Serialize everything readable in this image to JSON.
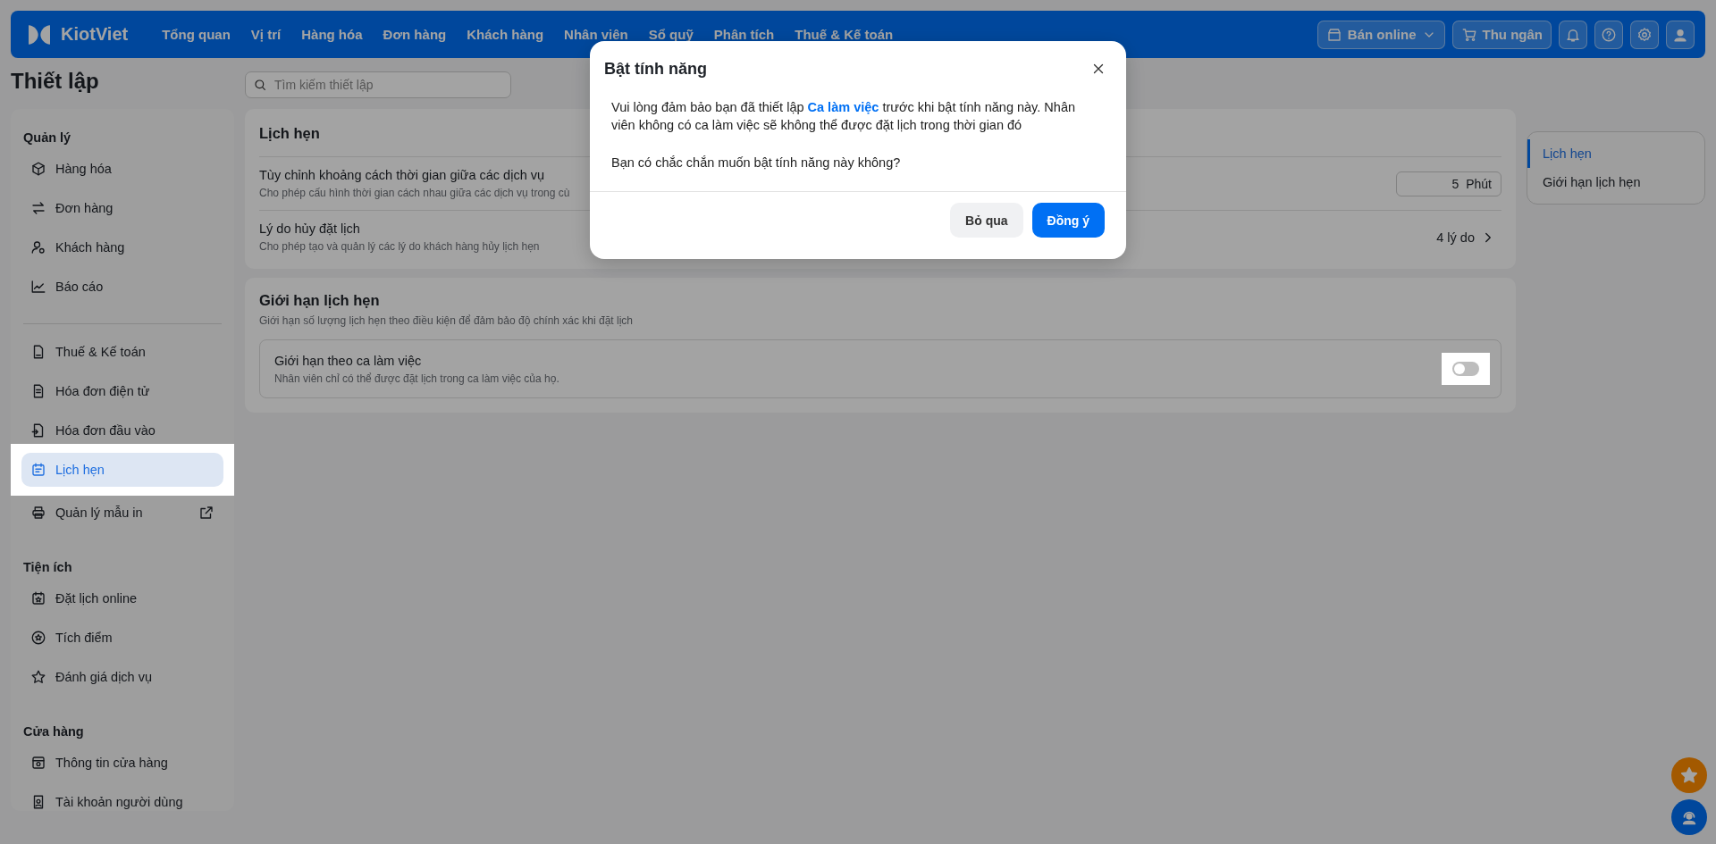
{
  "topbar": {
    "logo": "KiotViet",
    "menu": [
      "Tổng quan",
      "Vị trí",
      "Hàng hóa",
      "Đơn hàng",
      "Khách hàng",
      "Nhân viên",
      "Sổ quỹ",
      "Phân tích",
      "Thuế & Kế toán"
    ],
    "online_button": "Bán online",
    "cashier_button": "Thu ngân"
  },
  "page_title": "Thiết lập",
  "search": {
    "placeholder": "Tìm kiếm thiết lập"
  },
  "sidebar": {
    "sections": [
      {
        "title": "Quản lý",
        "items": [
          {
            "label": "Hàng hóa",
            "selected": false,
            "kind": "link"
          },
          {
            "label": "Đơn hàng",
            "selected": false,
            "kind": "link"
          },
          {
            "label": "Khách hàng",
            "selected": false,
            "kind": "link"
          },
          {
            "label": "Báo cáo",
            "selected": false,
            "kind": "link"
          }
        ]
      },
      {
        "items": [
          {
            "label": "Thuế & Kế toán",
            "selected": false,
            "kind": "link"
          },
          {
            "label": "Hóa đơn điện tử",
            "selected": false,
            "kind": "link"
          },
          {
            "label": "Hóa đơn đầu vào",
            "selected": false,
            "kind": "link"
          },
          {
            "label": "Lịch hẹn",
            "selected": true,
            "kind": "link"
          },
          {
            "label": "Quản lý mẫu in",
            "selected": false,
            "kind": "external"
          }
        ]
      },
      {
        "title": "Tiện ích",
        "items": [
          {
            "label": "Đặt lịch online",
            "selected": false,
            "kind": "link"
          },
          {
            "label": "Tích điểm",
            "selected": false,
            "kind": "link"
          },
          {
            "label": "Đánh giá dịch vụ",
            "selected": false,
            "kind": "link"
          }
        ]
      },
      {
        "title": "Cửa hàng",
        "items": [
          {
            "label": "Thông tin cửa hàng",
            "selected": false,
            "kind": "link"
          },
          {
            "label": "Tài khoản người dùng",
            "selected": false,
            "kind": "link"
          }
        ]
      }
    ]
  },
  "appointments": {
    "title": "Lịch hẹn",
    "rows": [
      {
        "kind": "stepper",
        "title": "Tùy chỉnh khoảng cách thời gian giữa các dịch vụ",
        "description": "Cho phép cấu hình thời gian cách nhau giữa các dịch vụ trong cù",
        "value": "5",
        "unit": "Phút"
      },
      {
        "kind": "link",
        "title": "Lý do hủy đặt lịch",
        "description": "Cho phép tạo và quản lý các lý do khách hàng hủy lịch hẹn",
        "value": "4 lý do"
      }
    ]
  },
  "limits": {
    "title": "Giới hạn lịch hẹn",
    "description": "Giới hạn số lượng lịch hẹn theo điều kiện để đảm bảo độ chính xác khi đặt lịch",
    "option": {
      "title": "Giới hạn theo ca làm việc",
      "description": "Nhân viên chỉ có thể được đặt lịch trong ca làm việc của họ.",
      "on": false
    }
  },
  "toc": [
    {
      "label": "Lịch hẹn",
      "selected": true
    },
    {
      "label": "Giới hạn lịch hẹn",
      "selected": false
    }
  ],
  "dialog": {
    "title": "Bật tính năng",
    "message": "Vui lòng đảm bảo bạn đã thiết lập **Ca làm việc** trước khi bật tính năng này. Nhân viên không có ca làm việc sẽ không thể được đặt lịch trong thời gian đó",
    "question": "Bạn có chắc chắn muốn bật tính năng này không?",
    "cancel": "Bỏ qua",
    "confirm": "Đồng ý"
  }
}
